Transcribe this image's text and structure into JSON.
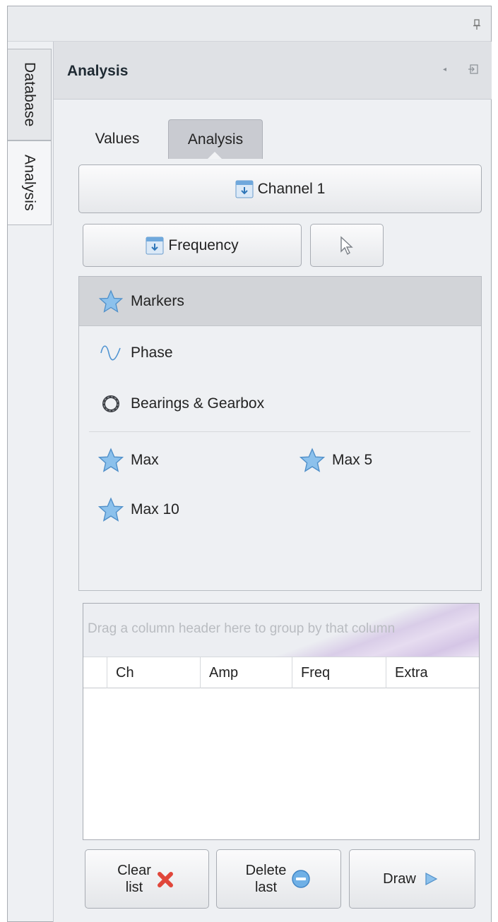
{
  "side_tabs": [
    {
      "label": "Database",
      "active": false
    },
    {
      "label": "Analysis",
      "active": true
    }
  ],
  "panel": {
    "title": "Analysis",
    "tabs": [
      {
        "label": "Values",
        "active": false
      },
      {
        "label": "Analysis",
        "active": true
      }
    ]
  },
  "buttons": {
    "channel": "Channel 1",
    "frequency": "Frequency"
  },
  "list": {
    "items": [
      {
        "label": "Markers",
        "icon": "star-icon",
        "selected": true
      },
      {
        "label": "Phase",
        "icon": "sine-wave-icon",
        "selected": false
      },
      {
        "label": "Bearings & Gearbox",
        "icon": "bearing-ring-icon",
        "selected": false
      }
    ],
    "grid_items": [
      {
        "label": "Max",
        "icon": "star-icon"
      },
      {
        "label": "Max 5",
        "icon": "star-icon"
      },
      {
        "label": "Max 10",
        "icon": "star-icon"
      }
    ]
  },
  "grid": {
    "group_hint": "Drag a column header here to group by that column",
    "columns": [
      "Ch",
      "Amp",
      "Freq",
      "Extra"
    ],
    "rows": []
  },
  "actions": {
    "clear": "Clear\nlist",
    "delete": "Delete\nlast",
    "draw": "Draw"
  },
  "colors": {
    "accent_blue": "#6fa8dc",
    "clear_red": "#e0463a",
    "selected_row": "#d2d4d8"
  }
}
